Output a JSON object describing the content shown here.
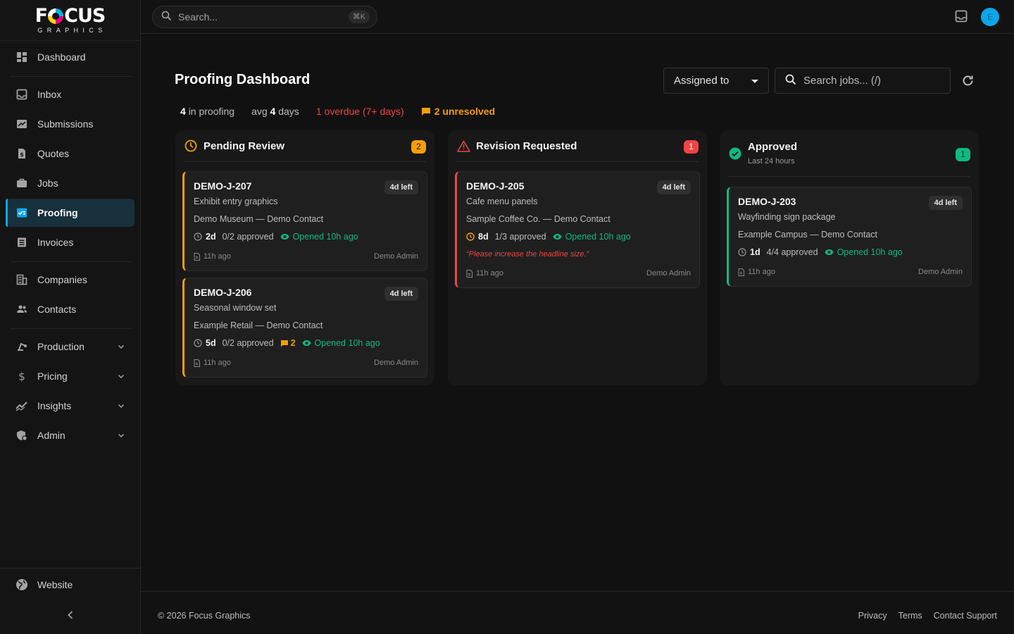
{
  "brand": {
    "name": "FOCUS",
    "tagline": "GRAPHICS"
  },
  "sidebar": {
    "items": [
      {
        "label": "Dashboard",
        "icon": "dashboard-icon"
      },
      {
        "label": "Inbox",
        "icon": "inbox-icon"
      },
      {
        "label": "Submissions",
        "icon": "submissions-icon"
      },
      {
        "label": "Quotes",
        "icon": "quotes-icon"
      },
      {
        "label": "Jobs",
        "icon": "briefcase-icon"
      },
      {
        "label": "Proofing",
        "icon": "proofing-icon",
        "active": true
      },
      {
        "label": "Invoices",
        "icon": "invoices-icon"
      },
      {
        "label": "Companies",
        "icon": "companies-icon"
      },
      {
        "label": "Contacts",
        "icon": "contacts-icon"
      },
      {
        "label": "Production",
        "icon": "production-icon",
        "expandable": true
      },
      {
        "label": "Pricing",
        "icon": "dollar-icon",
        "expandable": true
      },
      {
        "label": "Insights",
        "icon": "insights-icon",
        "expandable": true
      },
      {
        "label": "Admin",
        "icon": "admin-icon",
        "expandable": true
      }
    ],
    "website": "Website"
  },
  "topbar": {
    "search_placeholder": "Search...",
    "shortcut": "⌘K",
    "avatar_initial": "E"
  },
  "page": {
    "title": "Proofing Dashboard",
    "filter": {
      "selected": "Assigned to"
    },
    "job_search_placeholder": "Search jobs... (/)"
  },
  "stats": {
    "in_proofing_count": "4",
    "in_proofing_label": "in proofing",
    "avg_prefix": "avg",
    "avg_value": "4",
    "avg_unit": "days",
    "overdue": "1 overdue (7+ days)",
    "unresolved": "2 unresolved"
  },
  "columns": [
    {
      "title": "Pending Review",
      "subtitle": "",
      "count": "2",
      "accent": "#f59e0b",
      "cards": [
        {
          "id": "DEMO-J-207",
          "left": "4d left",
          "desc": "Exhibit entry graphics",
          "company": "Demo Museum — Demo Contact",
          "age": "2d",
          "approved": "0/2 approved",
          "comments": "",
          "opened": "Opened 10h ago",
          "note": "",
          "time": "11h ago",
          "user": "Demo Admin"
        },
        {
          "id": "DEMO-J-206",
          "left": "4d left",
          "desc": "Seasonal window set",
          "company": "Example Retail — Demo Contact",
          "age": "5d",
          "approved": "0/2 approved",
          "comments": "2",
          "opened": "Opened 10h ago",
          "note": "",
          "time": "11h ago",
          "user": "Demo Admin"
        }
      ]
    },
    {
      "title": "Revision Requested",
      "subtitle": "",
      "count": "1",
      "accent": "#ef4444",
      "cards": [
        {
          "id": "DEMO-J-205",
          "left": "4d left",
          "desc": "Cafe menu panels",
          "company": "Sample Coffee Co. — Demo Contact",
          "age": "8d",
          "approved": "1/3 approved",
          "comments": "",
          "opened": "Opened 10h ago",
          "note": "“Please increase the headline size.”",
          "time": "11h ago",
          "user": "Demo Admin"
        }
      ]
    },
    {
      "title": "Approved",
      "subtitle": "Last 24 hours",
      "count": "1",
      "accent": "#10b981",
      "cards": [
        {
          "id": "DEMO-J-203",
          "left": "4d left",
          "desc": "Wayfinding sign package",
          "company": "Example Campus — Demo Contact",
          "age": "1d",
          "approved": "4/4 approved",
          "comments": "",
          "opened": "Opened 10h ago",
          "note": "",
          "time": "11h ago",
          "user": "Demo Admin"
        }
      ]
    }
  ],
  "footer": {
    "copyright": "© 2026 Focus Graphics",
    "links": [
      "Privacy",
      "Terms",
      "Contact Support"
    ]
  }
}
